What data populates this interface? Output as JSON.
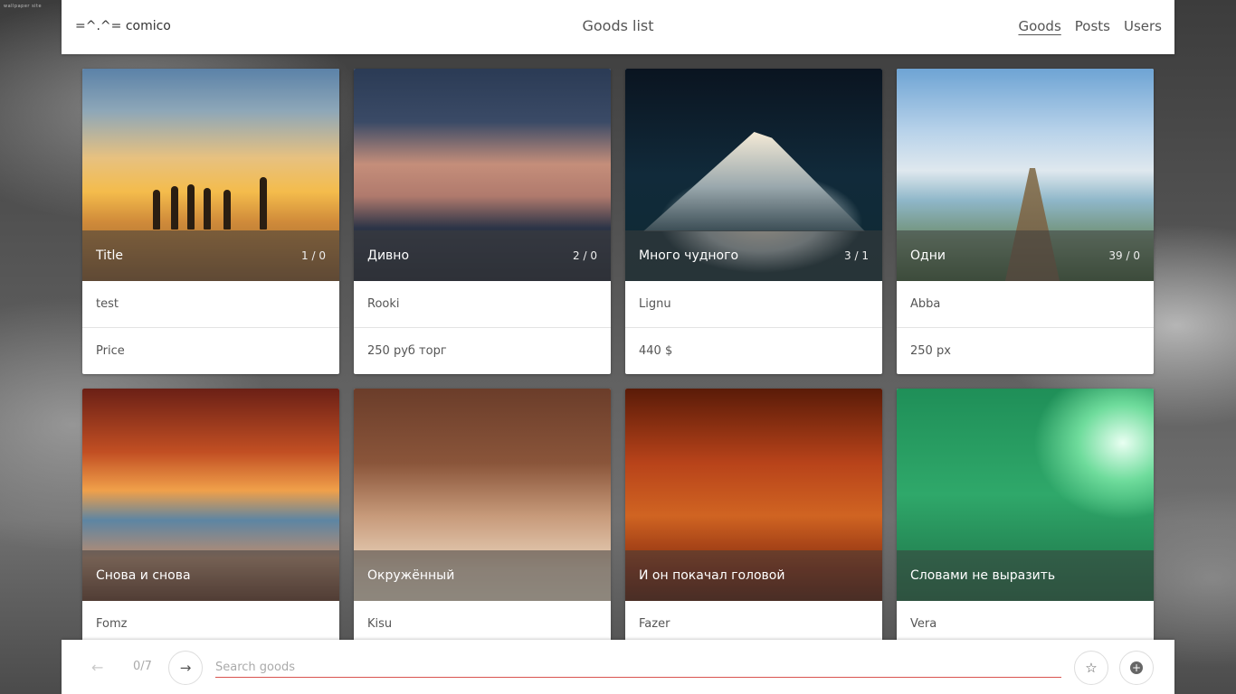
{
  "watermark": "wallpaper site",
  "header": {
    "logo": "=^.^= comico",
    "title": "Goods list",
    "nav": [
      {
        "label": "Goods",
        "active": true
      },
      {
        "label": "Posts",
        "active": false
      },
      {
        "label": "Users",
        "active": false
      }
    ]
  },
  "goods": [
    {
      "title": "Title",
      "counts": "1 / 0",
      "author": "test",
      "price": "Price"
    },
    {
      "title": "Дивно",
      "counts": "2 / 0",
      "author": "Rooki",
      "price": "250 руб торг"
    },
    {
      "title": "Много чудного",
      "counts": "3 / 1",
      "author": "Lignu",
      "price": "440 $"
    },
    {
      "title": "Одни",
      "counts": "39 / 0",
      "author": "Abba",
      "price": "250 px"
    },
    {
      "title": "Снова и снова",
      "counts": "",
      "author": "Fomz",
      "price": ""
    },
    {
      "title": "Окружённый",
      "counts": "",
      "author": "Kisu",
      "price": ""
    },
    {
      "title": "И он покачал головой",
      "counts": "",
      "author": "Fazer",
      "price": ""
    },
    {
      "title": "Словами не выразить",
      "counts": "",
      "author": "Vera",
      "price": ""
    }
  ],
  "pager": {
    "prev_icon": "arrow-left-icon",
    "page_info": "0/7",
    "next_icon": "arrow-right-icon"
  },
  "search": {
    "placeholder": "Search goods",
    "value": ""
  },
  "actions": {
    "favorite_icon": "star-icon",
    "add_icon": "plus-circle-icon"
  },
  "colors": {
    "search_underline": "#d9534f",
    "bar_bg": "#ffffff"
  }
}
